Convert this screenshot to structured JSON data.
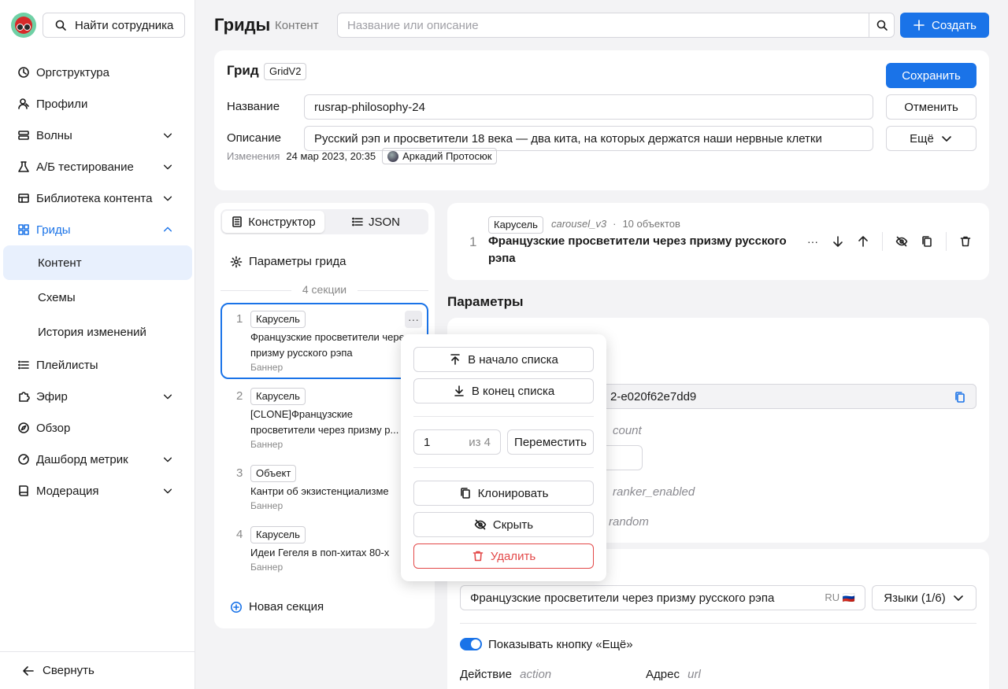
{
  "sidebar": {
    "find_label": "Найти сотрудника",
    "items": [
      {
        "label": "Оргструктура"
      },
      {
        "label": "Профили"
      },
      {
        "label": "Волны"
      },
      {
        "label": "А/Б тестирование"
      },
      {
        "label": "Библиотека контента"
      },
      {
        "label": "Гриды"
      },
      {
        "label": "Плейлисты"
      },
      {
        "label": "Эфир"
      },
      {
        "label": "Обзор"
      },
      {
        "label": "Дашборд метрик"
      },
      {
        "label": "Модерация"
      }
    ],
    "sub_items": [
      {
        "label": "Контент"
      },
      {
        "label": "Схемы"
      },
      {
        "label": "История изменений"
      }
    ],
    "collapse_label": "Свернуть"
  },
  "header": {
    "title": "Гриды",
    "subtitle": "Контент",
    "search_placeholder": "Название или описание",
    "create_label": "Создать"
  },
  "grid": {
    "title": "Грид",
    "type_chip": "GridV2",
    "name_label": "Название",
    "name_value": "rusrap-philosophy-24",
    "desc_label": "Описание",
    "desc_value": "Русский рэп и просветители 18 века — два кита, на которых держатся наши нервные клетки",
    "save_label": "Сохранить",
    "cancel_label": "Отменить",
    "more_label": "Ещё",
    "changes_label": "Изменения",
    "changes_date": "24 мар 2023, 20:35",
    "author": "Аркадий Протосюк"
  },
  "left_panel": {
    "tab_constructor": "Конструктор",
    "tab_json": "JSON",
    "grid_params": "Параметры грида",
    "sections_count": "4 секции",
    "sections": [
      {
        "num": "1",
        "chip": "Карусель",
        "title": "Французские просветители через призму русского рэпа",
        "kind": "Баннер"
      },
      {
        "num": "2",
        "chip": "Карусель",
        "title": "[CLONE]Французские просветители через призму р...",
        "kind": "Баннер"
      },
      {
        "num": "3",
        "chip": "Объект",
        "title": "Кантри об экзистенциализме",
        "kind": "Баннер"
      },
      {
        "num": "4",
        "chip": "Карусель",
        "title": "Идеи Гегеля в поп-хитах 80-х",
        "kind": "Баннер"
      }
    ],
    "more_dots": "···",
    "new_section": "Новая секция"
  },
  "section_card": {
    "num": "1",
    "chip": "Карусель",
    "type_key": "carousel_v3",
    "dot": "·",
    "count": "10 объектов",
    "title": "Французские просветители через призму русского рэпа",
    "more_dots": "···"
  },
  "params": {
    "heading": "Параметры",
    "id_value": "2-e020f62e7dd9",
    "count_key": "count",
    "ranker_key": "ranker_enabled",
    "random_key": "random"
  },
  "lang_block": {
    "title_value": "Французские просветители через призму русского рэпа",
    "lang_badge": "RU 🇷🇺",
    "languages_label": "Языки (1/6)",
    "show_more_label": "Показывать кнопку «Ещё»",
    "action_label": "Действие",
    "action_key": "action",
    "address_label": "Адрес",
    "address_key": "url"
  },
  "popup": {
    "to_start": "В начало списка",
    "to_end": "В конец списка",
    "position_value": "1",
    "of_total": "из 4",
    "move": "Переместить",
    "clone": "Клонировать",
    "hide": "Скрыть",
    "delete": "Удалить"
  },
  "colors": {
    "accent": "#1a73e8",
    "danger": "#e34848"
  }
}
